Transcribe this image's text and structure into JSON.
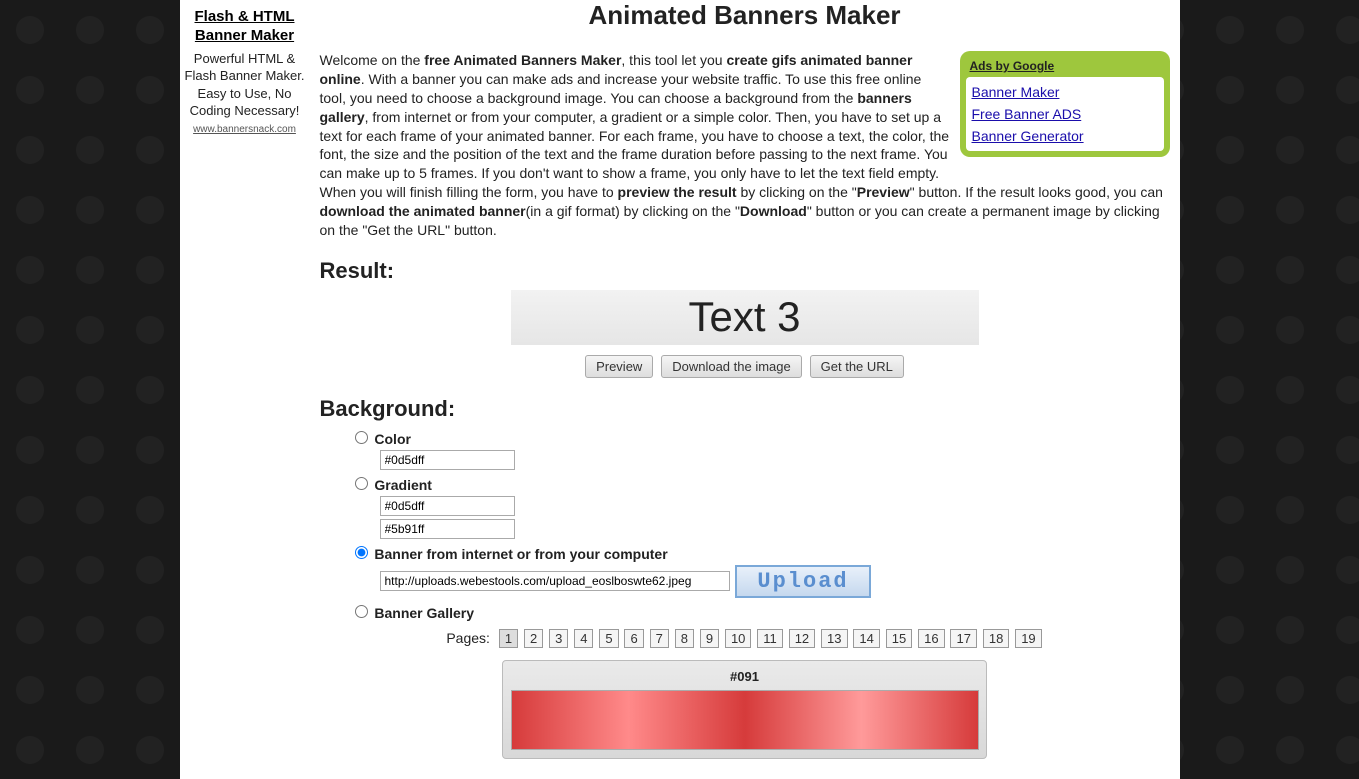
{
  "sidebar": {
    "title": "Flash & HTML Banner Maker",
    "desc": "Powerful HTML & Flash Banner Maker. Easy to Use, No Coding Necessary!",
    "link": "www.bannersnack.com"
  },
  "title": "Animated Banners Maker",
  "ads": {
    "header": "Ads by Google",
    "links": [
      "Banner Maker",
      "Free Banner ADS",
      "Banner Generator"
    ]
  },
  "intro": {
    "p1a": "Welcome on the ",
    "p1b": "free Animated Banners Maker",
    "p1c": ", this tool let you ",
    "p1d": "create gifs animated banner online",
    "p1e": ". With a banner you can make ads and increase your website traffic. To use this free online tool, you need to choose a background image. You can choose a background from the ",
    "p1f": "banners gallery",
    "p1g": ", from internet or from your computer, a gradient or a simple color. Then, you have to set up a text for each frame of your animated banner. For each frame, you have to choose a text, the color, the font, the size and the position of the text and the frame duration before passing to the next frame. You can make up to 5 frames. If you don't want to show a frame, you only have to let the text field empty. When you will finish filling the form, you have to ",
    "p1h": "preview the result",
    "p1i": " by clicking on the \"",
    "p1j": "Preview",
    "p1k": "\" button. If the result looks good, you can ",
    "p1l": "download the animated banner",
    "p1m": "(in a gif format) by clicking on the \"",
    "p1n": "Download",
    "p1o": "\" button or you can create a permanent image by clicking on the \"Get the URL\" button."
  },
  "result": {
    "heading": "Result:",
    "text": "Text 3"
  },
  "buttons": {
    "preview": "Preview",
    "download": "Download the image",
    "geturl": "Get the URL"
  },
  "bg": {
    "heading": "Background:",
    "color_label": "Color",
    "color_value": "#0d5dff",
    "gradient_label": "Gradient",
    "gradient_from": "#0d5dff",
    "gradient_to": "#5b91ff",
    "url_label": "Banner from internet or from your computer",
    "url_value": "http://uploads.webestools.com/upload_eoslboswte62.jpeg",
    "upload_label": "Upload",
    "gallery_label": "Banner Gallery"
  },
  "pager": {
    "label": "Pages:",
    "pages": [
      "1",
      "2",
      "3",
      "4",
      "5",
      "6",
      "7",
      "8",
      "9",
      "10",
      "11",
      "12",
      "13",
      "14",
      "15",
      "16",
      "17",
      "18",
      "19"
    ]
  },
  "gallery": {
    "caption": "#091"
  }
}
